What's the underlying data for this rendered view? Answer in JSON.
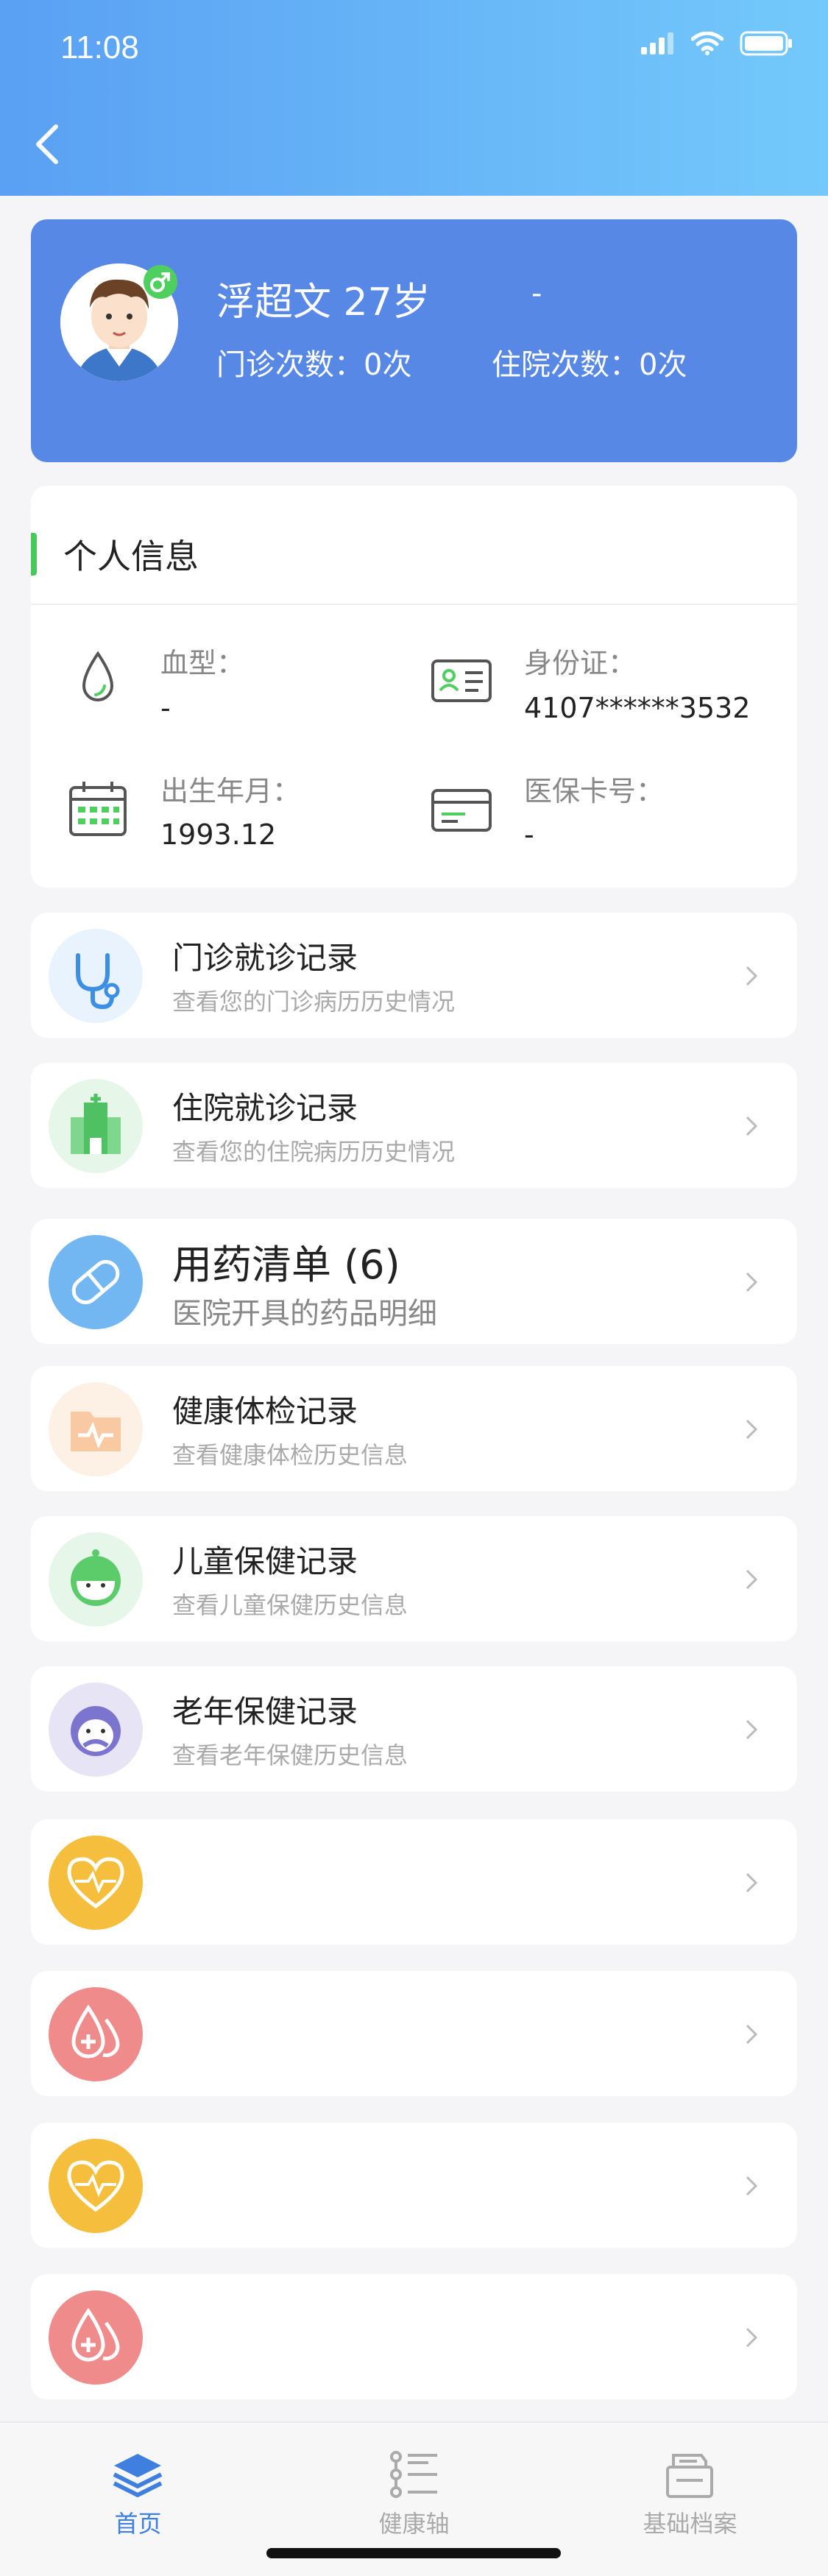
{
  "status_bar": {
    "time": "11:08"
  },
  "profile": {
    "name_age": "浮超文 27岁",
    "extra": "-",
    "outpatient_count": "门诊次数：0次",
    "inpatient_count": "住院次数：0次",
    "gender_symbol": "♂"
  },
  "personal_info": {
    "title": "个人信息",
    "blood_type": {
      "label": "血型：",
      "value": "-"
    },
    "id_card": {
      "label": "身份证：",
      "value": "4107******3532"
    },
    "birth": {
      "label": "出生年月：",
      "value": "1993.12"
    },
    "insurance": {
      "label": "医保卡号：",
      "value": "-"
    }
  },
  "menu": {
    "items": [
      {
        "title": "门诊就诊记录",
        "subtitle": "查看您的门诊病历历史情况",
        "icon": "stethoscope-icon"
      },
      {
        "title": "住院就诊记录",
        "subtitle": "查看您的住院病历历史情况",
        "icon": "hospital-icon"
      },
      {
        "title": "用药清单  (6)",
        "subtitle": "医院开具的药品明细",
        "icon": "pill-icon"
      },
      {
        "title": "健康体检记录",
        "subtitle": "查看健康体检历史信息",
        "icon": "health-folder-icon"
      },
      {
        "title": "儿童保健记录",
        "subtitle": "查看儿童保健历史信息",
        "icon": "child-icon"
      },
      {
        "title": "老年保健记录",
        "subtitle": "查看老年保健历史信息",
        "icon": "elder-icon"
      },
      {
        "title": "",
        "subtitle": "",
        "icon": "heart-pulse-icon"
      },
      {
        "title": "",
        "subtitle": "",
        "icon": "blood-drop-icon"
      },
      {
        "title": "",
        "subtitle": "",
        "icon": "heart-pulse-icon"
      },
      {
        "title": "",
        "subtitle": "",
        "icon": "blood-drop-icon"
      }
    ]
  },
  "tabbar": {
    "home": "首页",
    "timeline": "健康轴",
    "records": "基础档案",
    "active_color": "#3f7fe0",
    "inactive_color": "#aaaaaa"
  }
}
